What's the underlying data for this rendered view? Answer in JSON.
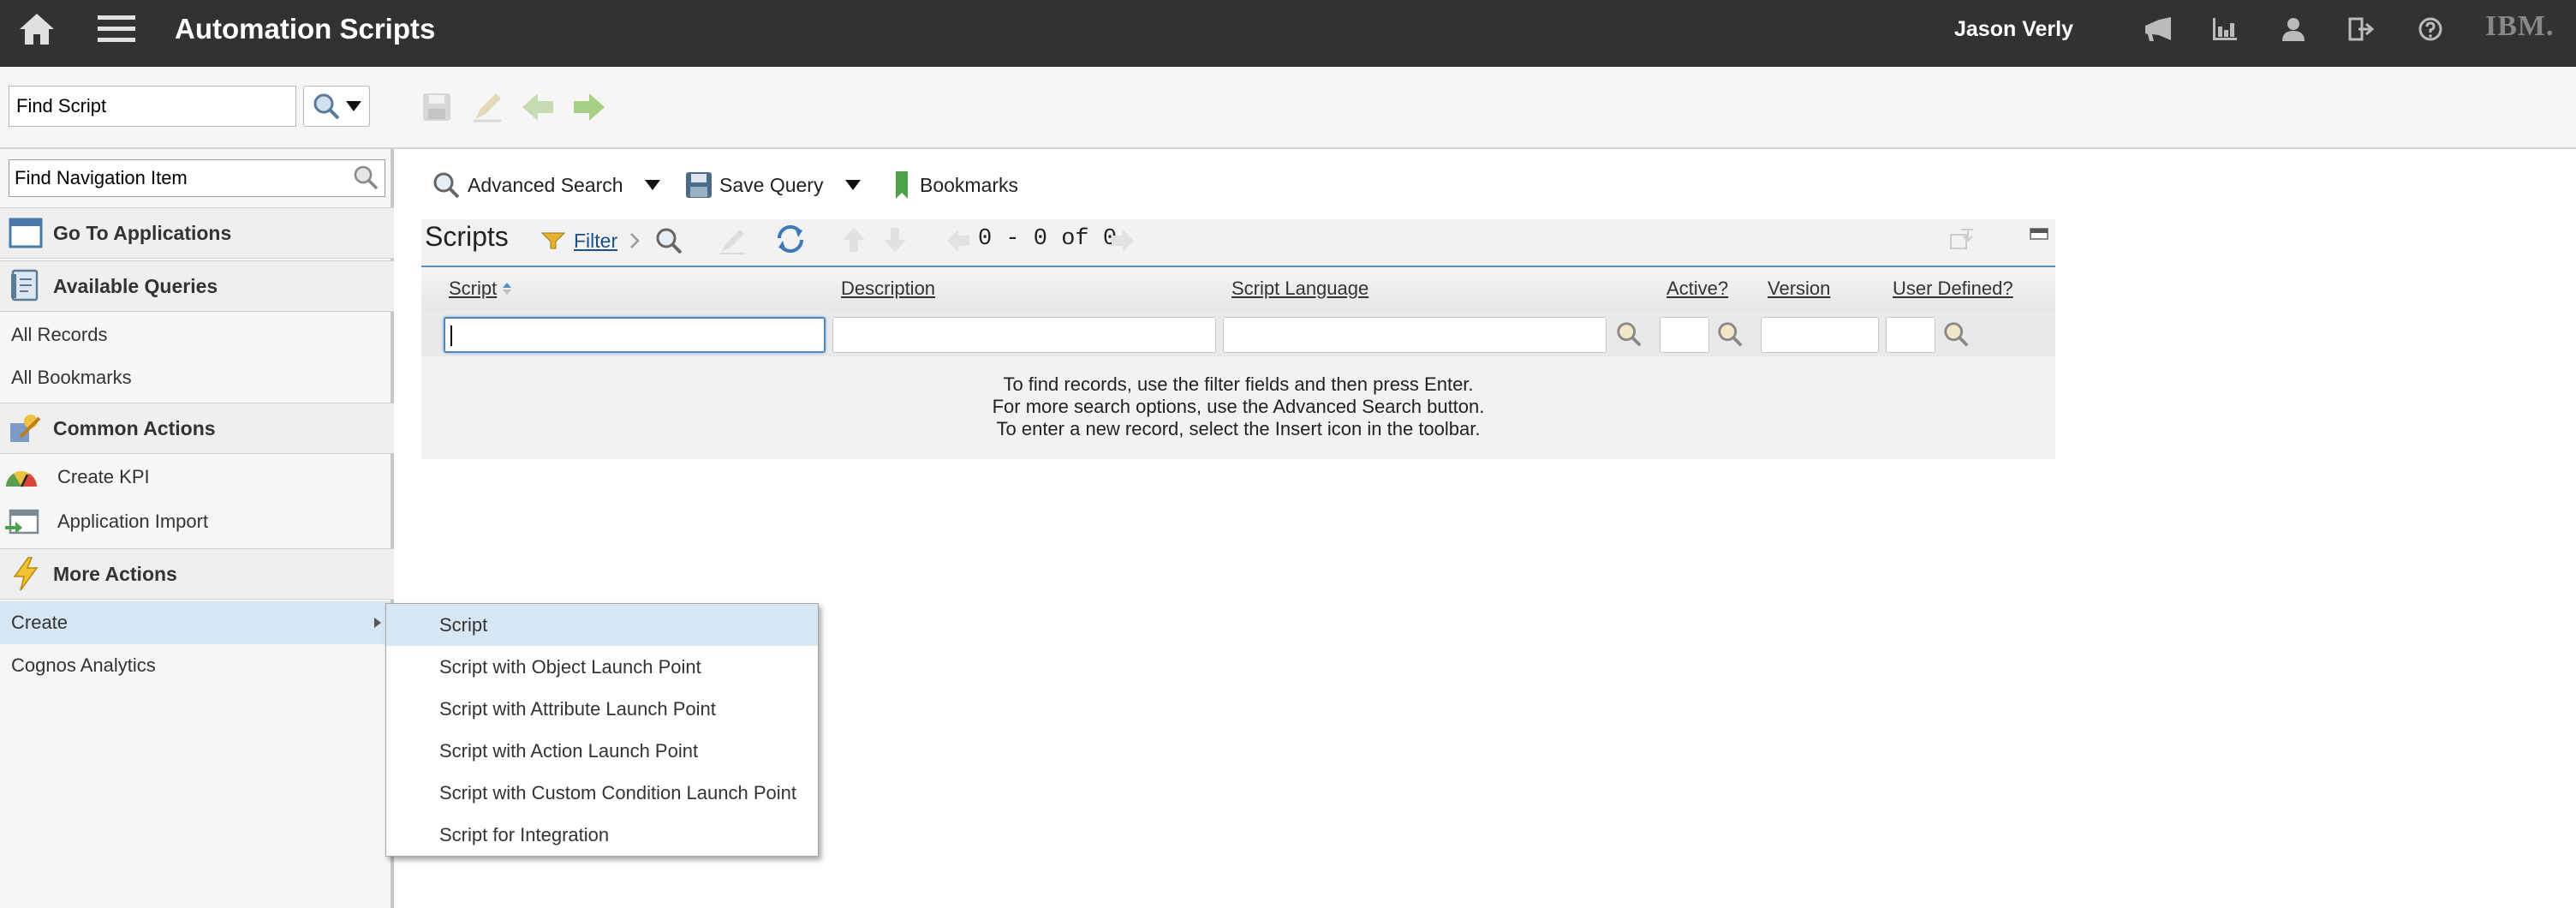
{
  "header": {
    "app_title": "Automation Scripts",
    "user_name": "Jason Verly",
    "logo_text": "IBM.",
    "icons": [
      "home-icon",
      "hamburger-menu-icon",
      "bulletins-icon",
      "reports-icon",
      "profile-icon",
      "sign-out-icon",
      "help-icon"
    ]
  },
  "toolbar": {
    "find_script_value": "Find Script",
    "icons": [
      "search-icon",
      "dropdown-arrow-icon",
      "save-icon",
      "clear-changes-icon",
      "previous-record-icon",
      "next-record-icon"
    ]
  },
  "sidebar": {
    "nav_search_value": "Find Navigation Item",
    "sections": {
      "go_to_apps": "Go To Applications",
      "queries": "Available Queries",
      "common": "Common Actions",
      "more": "More Actions"
    },
    "query_items": [
      "All Records",
      "All Bookmarks"
    ],
    "common_items": [
      "Create KPI",
      "Application Import"
    ],
    "more_items": [
      "Create",
      "Cognos Analytics"
    ]
  },
  "main": {
    "advanced_search": "Advanced Search",
    "save_query": "Save Query",
    "bookmarks": "Bookmarks",
    "results_title": "Scripts",
    "filter_label": "Filter",
    "paging": "0 - 0 of 0",
    "columns": [
      "Script",
      "Description",
      "Script Language",
      "Active?",
      "Version",
      "User Defined?"
    ],
    "messages": [
      "To find records, use the filter fields and then press Enter.",
      "For more search options, use the Advanced Search button.",
      "To enter a new record, select the Insert icon in the toolbar."
    ]
  },
  "context_menu": {
    "items": [
      "Script",
      "Script with Object Launch Point",
      "Script with Attribute Launch Point",
      "Script with Action Launch Point",
      "Script with Custom Condition Launch Point",
      "Script for Integration"
    ]
  },
  "colors": {
    "header_bg": "#323232",
    "accent_blue": "#5b8fba",
    "highlight": "#d6e6f2"
  }
}
